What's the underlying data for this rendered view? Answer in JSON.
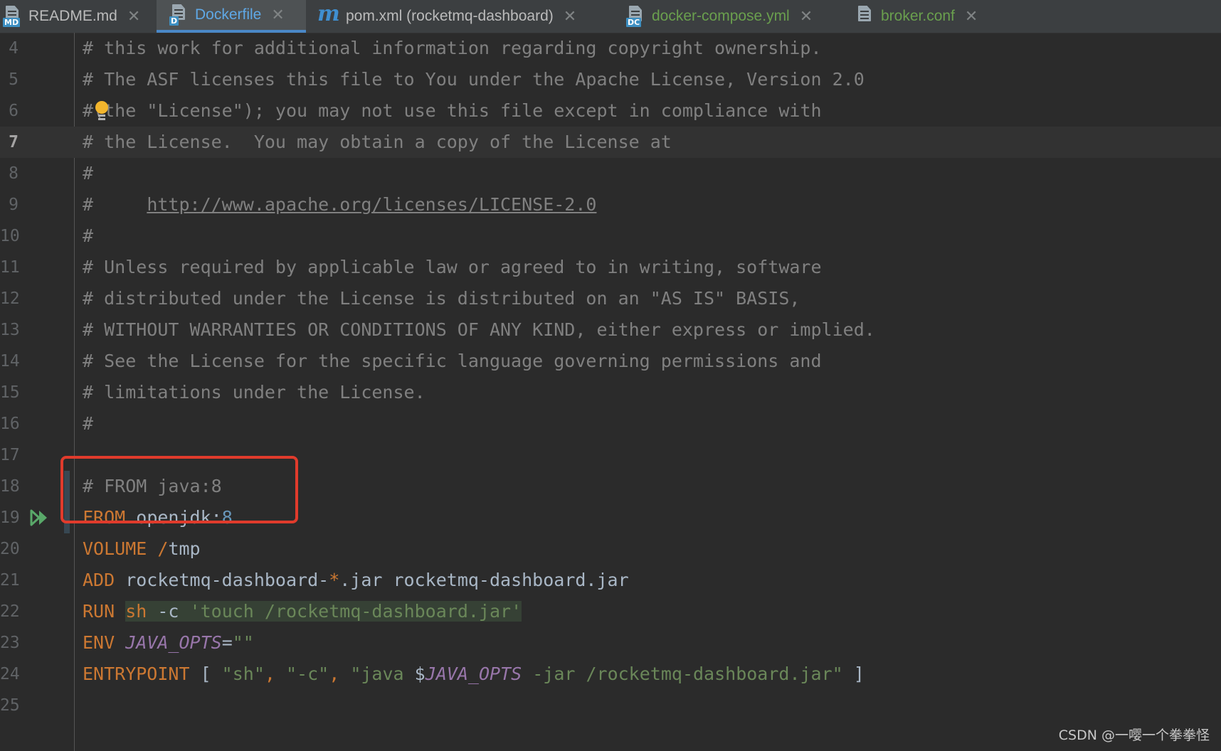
{
  "tabs": [
    {
      "label": "README.md",
      "badge": "MD",
      "color": "#bbbbbb",
      "active": false
    },
    {
      "label": "Dockerfile",
      "badge": "D",
      "color": "#5fa8e6",
      "active": true
    },
    {
      "label": "pom.xml (rocketmq-dashboard)",
      "badge": "m",
      "color": "#bbbbbb",
      "active": false
    },
    {
      "label": "docker-compose.yml",
      "badge": "DC",
      "color": "#6a9f4e",
      "active": false
    },
    {
      "label": "broker.conf",
      "badge": "",
      "color": "#6a9f4e",
      "active": false
    }
  ],
  "tab_close_glyph": "✕",
  "editor": {
    "current_line": 7,
    "line_numbers": [
      "4",
      "5",
      "6",
      "7",
      "8",
      "9",
      "10",
      "11",
      "12",
      "13",
      "14",
      "15",
      "16",
      "17",
      "18",
      "19",
      "20",
      "21",
      "22",
      "23",
      "24",
      "25"
    ],
    "comments": {
      "l4": "# this work for additional information regarding copyright ownership.",
      "l5": "# The ASF licenses this file to You under the Apache License, Version 2.0",
      "l6_hash": "#",
      "l6_rest": "(the \"License\"); you may not use this file except in compliance with",
      "l7": "# the License.  You may obtain a copy of the License at",
      "l8": "#",
      "l9_hash": "#     ",
      "l9_url": "http://www.apache.org/licenses/LICENSE-2.0",
      "l10": "#",
      "l11": "# Unless required by applicable law or agreed to in writing, software",
      "l12": "# distributed under the License is distributed on an \"AS IS\" BASIS,",
      "l13": "# WITHOUT WARRANTIES OR CONDITIONS OF ANY KIND, either express or implied.",
      "l14": "# See the License for the specific language governing permissions and",
      "l15": "# limitations under the License.",
      "l16": "#",
      "l18": "# FROM java:8"
    },
    "code": {
      "l19_kw": "FROM",
      "l19_image": " openjdk:",
      "l19_tag": "8",
      "l20_kw": "VOLUME",
      "l20_sp": " ",
      "l20_slash": "/",
      "l20_path": "tmp",
      "l21_kw": "ADD",
      "l21_a": " rocketmq-dashboard-",
      "l21_star": "*",
      "l21_b": ".jar rocketmq-dashboard.jar",
      "l22_kw": "RUN",
      "l22_sp": " ",
      "l22_sh": "sh",
      "l22_flag": " -c ",
      "l22_str": "'touch /rocketmq-dashboard.jar'",
      "l23_kw": "ENV",
      "l23_sp": " ",
      "l23_var": "JAVA_OPTS",
      "l23_eq": "=",
      "l23_val": "\"\"",
      "l24_kw": "ENTRYPOINT",
      "l24_open": " [ ",
      "l24_s1": "\"sh\"",
      "l24_c1": ", ",
      "l24_s2": "\"-c\"",
      "l24_c2": ", ",
      "l24_s3a": "\"java ",
      "l24_dollar": "$",
      "l24_var": "JAVA_OPTS",
      "l24_s3b": " -jar /rocketmq-dashboard.jar\"",
      "l24_close": " ]"
    }
  },
  "watermark": "CSDN @一嘤一个拳拳怪",
  "colors": {
    "background": "#2b2b2b",
    "keyword": "#cc7832",
    "string": "#6a8759",
    "comment": "#808080",
    "number": "#6897bb",
    "variable": "#9876aa",
    "highlight_box": "#e03b2c",
    "active_tab_underline": "#4a88c7"
  }
}
